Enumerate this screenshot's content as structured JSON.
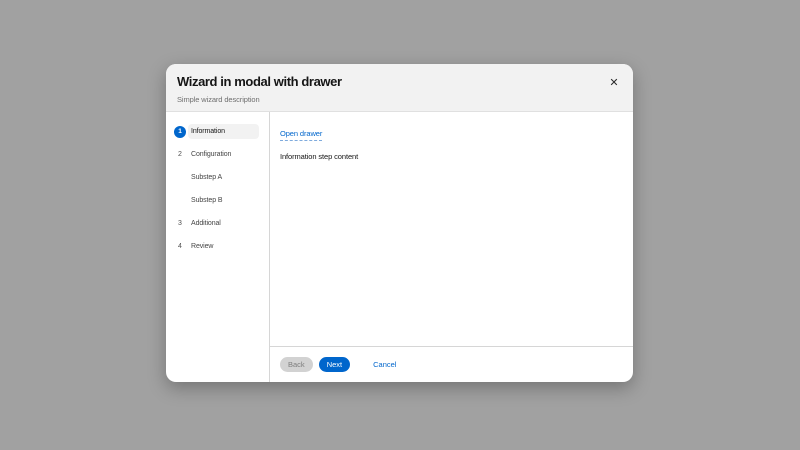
{
  "modal": {
    "title": "Wizard in modal with drawer",
    "description": "Simple wizard description",
    "close_icon": "✕"
  },
  "wizard": {
    "steps": [
      {
        "number": "1",
        "label": "Information",
        "state": "active"
      },
      {
        "number": "2",
        "label": "Configuration",
        "state": "default"
      },
      {
        "number": "",
        "label": "Substep A",
        "state": "substep"
      },
      {
        "number": "",
        "label": "Substep B",
        "state": "substep"
      },
      {
        "number": "3",
        "label": "Additional",
        "state": "default"
      },
      {
        "number": "4",
        "label": "Review",
        "state": "default"
      }
    ],
    "content": {
      "drawer_link": "Open drawer",
      "body_text": "Information step content"
    },
    "footer": {
      "back_label": "Back",
      "next_label": "Next",
      "cancel_label": "Cancel"
    }
  },
  "colors": {
    "backdrop": "#a1a1a1",
    "brand_blue": "#0066cc",
    "header_bg": "#f2f2f2",
    "active_step_bg": "#f2f2f2",
    "disabled_button_bg": "#d2d2d2"
  }
}
